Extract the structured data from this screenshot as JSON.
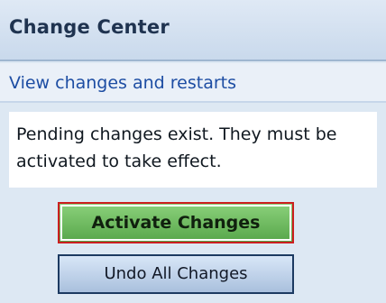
{
  "panel": {
    "title": "Change Center",
    "link_text": "View changes and restarts",
    "message": "Pending changes exist. They must be activated to take effect.",
    "buttons": {
      "activate_label": "Activate Changes",
      "undo_label": "Undo All Changes"
    },
    "colors": {
      "header_bg": "#c9d9ec",
      "link": "#1d4da3",
      "activate_green": "#57a64a",
      "activate_border": "#cc1f1f",
      "undo_bg": "#a9c0dd"
    }
  }
}
